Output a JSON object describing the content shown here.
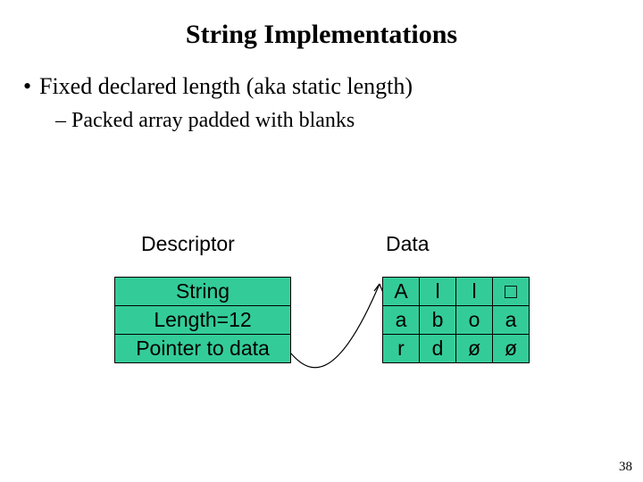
{
  "title": "String Implementations",
  "bullet1": "Fixed declared length (aka static length)",
  "bullet2": "Packed array padded with blanks",
  "labels": {
    "descriptor": "Descriptor",
    "data": "Data"
  },
  "descriptor": {
    "row0": "String",
    "row1": "Length=12",
    "row2": "Pointer to data"
  },
  "dataGrid": {
    "r0c0": "A",
    "r0c1": "l",
    "r0c2": "l",
    "r0c3": "□",
    "r1c0": "a",
    "r1c1": "b",
    "r1c2": "o",
    "r1c3": "a",
    "r2c0": "r",
    "r2c1": "d",
    "r2c2": "ø",
    "r2c3": "ø"
  },
  "pageNumber": "38",
  "colors": {
    "cellFill": "#33cc99"
  }
}
